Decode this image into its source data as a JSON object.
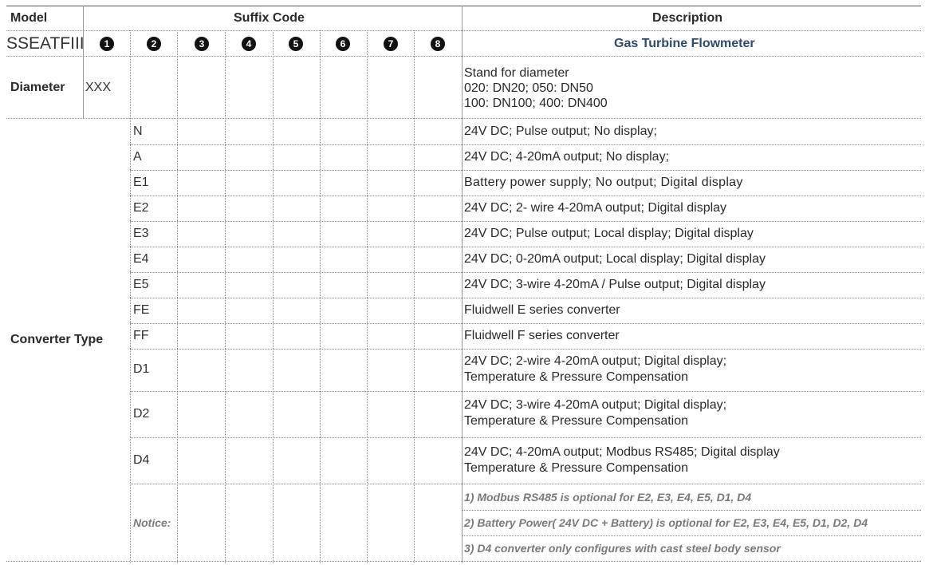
{
  "header": {
    "model": "Model",
    "suffix_code": "Suffix Code",
    "description": "Description"
  },
  "model_row": {
    "model_code": "SSEATFIII",
    "digits": [
      "1",
      "2",
      "3",
      "4",
      "5",
      "6",
      "7",
      "8"
    ],
    "title": "Gas Turbine Flowmeter"
  },
  "diameter": {
    "label": "Diameter",
    "code": "XXX",
    "lines": [
      "Stand for diameter",
      "020: DN20; 050: DN50",
      "100: DN100; 400: DN400"
    ]
  },
  "converter": {
    "label": "Converter Type",
    "rows": [
      {
        "code": "N",
        "lines": [
          "24V DC; Pulse output; No display;"
        ]
      },
      {
        "code": "A",
        "lines": [
          "24V DC; 4-20mA output; No display;"
        ]
      },
      {
        "code": "E1",
        "lines": [
          "Battery power supply; No output; Digital display"
        ]
      },
      {
        "code": "E2",
        "lines": [
          "24V DC; 2- wire 4-20mA output; Digital display"
        ]
      },
      {
        "code": "E3",
        "lines": [
          "24V DC; Pulse output; Local display; Digital display"
        ]
      },
      {
        "code": "E4",
        "lines": [
          "24V DC; 0-20mA output; Local display; Digital display"
        ]
      },
      {
        "code": "E5",
        "lines": [
          "24V DC; 3-wire 4-20mA / Pulse  output; Digital display"
        ]
      },
      {
        "code": "FE",
        "lines": [
          "Fluidwell E series converter"
        ]
      },
      {
        "code": "FF",
        "lines": [
          "Fluidwell F series converter"
        ]
      },
      {
        "code": "D1",
        "lines": [
          "24V DC;  2-wire 4-20mA output;  Digital display;",
          "Temperature & Pressure Compensation"
        ]
      },
      {
        "code": "D2",
        "lines": [
          "24V DC; 3-wire 4-20mA output;  Digital display;",
          "Temperature & Pressure Compensation"
        ]
      },
      {
        "code": "D4",
        "lines": [
          "24V DC; 4-20mA output; Modbus RS485; Digital display",
          "Temperature & Pressure  Compensation"
        ]
      }
    ]
  },
  "notice": {
    "label": "Notice:",
    "items": [
      "1) Modbus RS485 is optional for E2, E3, E4, E5, D1, D4",
      "2) Battery Power( 24V DC + Battery) is optional for E2, E3, E4, E5, D1, D2,  D4",
      "3) D4 converter only configures with cast steel body sensor"
    ]
  }
}
